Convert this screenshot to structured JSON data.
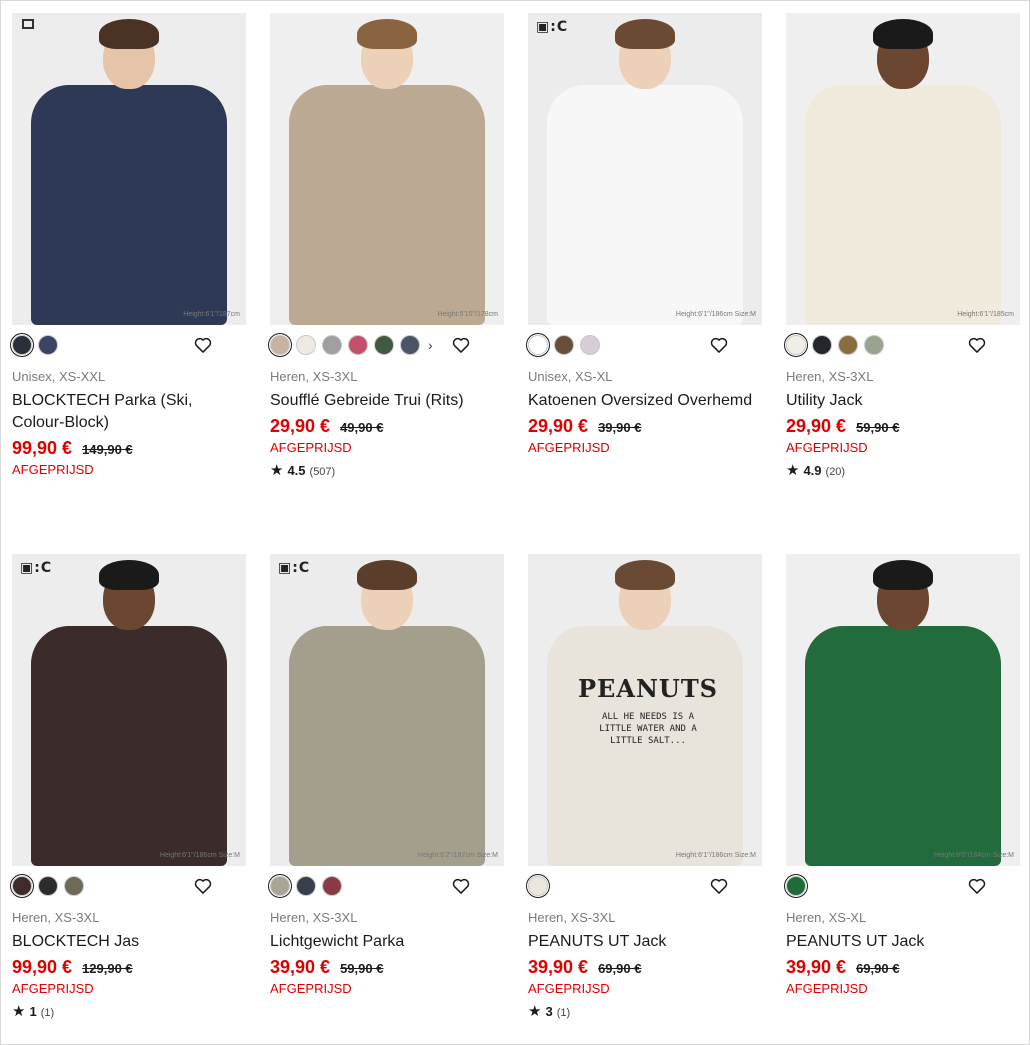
{
  "colors": {
    "price_red": "#e00000",
    "text": "#1b1b1b",
    "muted": "#7b7b7b"
  },
  "products": [
    {
      "brand_tag": "",
      "size_note": "Height:6'1\"/187cm",
      "swatches": [
        "#2b2f3a",
        "#3a4466"
      ],
      "selected": 0,
      "more": false,
      "meta": "Unisex, XS-XXL",
      "name": "BLOCKTECH Parka (Ski, Colour-Block)",
      "price": "99,90 €",
      "old_price": "149,90 €",
      "flag": "AFGEPRIJSD",
      "rating": null,
      "rating_count": null,
      "look": {
        "bg": "#ededed",
        "body": "#2e3a55",
        "hair": "#4a3325",
        "skin": "#e5c4aa",
        "legs": "#cfcfcf"
      }
    },
    {
      "brand_tag": "",
      "size_note": "Height:5'10\"/178cm",
      "swatches": [
        "#c7b3a2",
        "#eeeae2",
        "#9f9f9f",
        "#c4516a",
        "#3f5a3f",
        "#4b5566"
      ],
      "selected": 0,
      "more": true,
      "meta": "Heren, XS-3XL",
      "name": "Soufflé Gebreide Trui (Rits)",
      "price": "29,90 €",
      "old_price": "49,90 €",
      "flag": "AFGEPRIJSD",
      "rating": "4.5",
      "rating_count": "(507)",
      "look": {
        "bg": "#efefef",
        "body": "#bca993",
        "hair": "#8a6440",
        "skin": "#ecd0b8",
        "legs": "#3b2d26"
      }
    },
    {
      "brand_tag": "▣:C",
      "size_note": "Height:6'1\"/186cm Size:M",
      "swatches": [
        "#ffffff",
        "#6b4e3a",
        "#d8cdd4"
      ],
      "selected": 0,
      "more": false,
      "meta": "Unisex, XS-XL",
      "name": "Katoenen Oversized Overhemd",
      "price": "29,90 €",
      "old_price": "39,90 €",
      "flag": "AFGEPRIJSD",
      "rating": null,
      "rating_count": null,
      "look": {
        "bg": "#ececec",
        "body": "#f7f7f7",
        "hair": "#6a4a32",
        "skin": "#ecd0b8",
        "legs": "#ece6d6"
      }
    },
    {
      "brand_tag": "",
      "size_note": "Height:6'1\"/185cm",
      "swatches": [
        "#f1eee3",
        "#24262d",
        "#8b6e3e",
        "#9aa390"
      ],
      "selected": 0,
      "more": false,
      "meta": "Heren, XS-3XL",
      "name": "Utility Jack",
      "price": "29,90 €",
      "old_price": "59,90 €",
      "flag": "AFGEPRIJSD",
      "rating": "4.9",
      "rating_count": "(20)",
      "look": {
        "bg": "#efefef",
        "body": "#efeadb",
        "hair": "#1a1a1a",
        "skin": "#6b4630",
        "legs": "#3d5777"
      }
    },
    {
      "brand_tag": "▣:C",
      "size_note": "Height:6'1\"/186cm Size:M",
      "swatches": [
        "#3e2c2a",
        "#2c2c2c",
        "#6e6a55"
      ],
      "selected": 0,
      "more": false,
      "meta": "Heren, XS-3XL",
      "name": "BLOCKTECH Jas",
      "price": "99,90 €",
      "old_price": "129,90 €",
      "flag": "AFGEPRIJSD",
      "rating": "1",
      "rating_count": "(1)",
      "look": {
        "bg": "#ededed",
        "body": "#3b2b2b",
        "hair": "#1a1a1a",
        "skin": "#6b4630",
        "legs": "#5b524a"
      }
    },
    {
      "brand_tag": "▣:C",
      "size_note": "Height:6'2\"/187cm Size:M",
      "swatches": [
        "#a8a595",
        "#3a3f4d",
        "#8b3a44"
      ],
      "selected": 0,
      "more": false,
      "meta": "Heren, XS-3XL",
      "name": "Lichtgewicht Parka",
      "price": "39,90 €",
      "old_price": "59,90 €",
      "flag": "AFGEPRIJSD",
      "rating": null,
      "rating_count": null,
      "look": {
        "bg": "#ececec",
        "body": "#a39f8c",
        "hair": "#5a3e2b",
        "skin": "#ecd0b8",
        "legs": "#d6d6d6"
      }
    },
    {
      "brand_tag": "",
      "size_note": "Height:6'1\"/186cm Size:M",
      "swatches": [
        "#ebe7df"
      ],
      "selected": 0,
      "more": false,
      "meta": "Heren, XS-3XL",
      "name": "PEANUTS UT Jack",
      "price": "39,90 €",
      "old_price": "69,90 €",
      "flag": "AFGEPRIJSD",
      "rating": "3",
      "rating_count": "(1)",
      "print_title": "PEANUTS",
      "print_text": "ALL HE NEEDS IS A LITTLE WATER AND A LITTLE SALT...",
      "look": {
        "bg": "#ededed",
        "body": "#e9e4db",
        "hair": "#6b4a34",
        "skin": "#ecd0b8",
        "legs": "#e9e4db"
      }
    },
    {
      "brand_tag": "",
      "size_note": "Height:6'0\"/184cm Size:M",
      "swatches": [
        "#1f6b3a"
      ],
      "selected": 0,
      "more": false,
      "meta": "Heren, XS-XL",
      "name": "PEANUTS UT Jack",
      "price": "39,90 €",
      "old_price": "69,90 €",
      "flag": "AFGEPRIJSD",
      "rating": null,
      "rating_count": null,
      "look": {
        "bg": "#efefef",
        "body": "#216b3c",
        "hair": "#1a1a1a",
        "skin": "#6b4630",
        "legs": "#b8a27c"
      }
    }
  ]
}
